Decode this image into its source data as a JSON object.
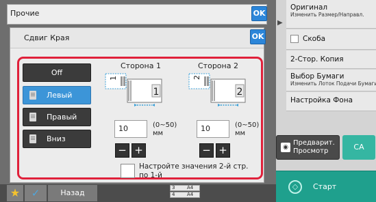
{
  "right_panel": {
    "items": [
      {
        "title": "Оригинал",
        "subtitle": "Изменить Размер/Направл."
      },
      {
        "title": "Скоба",
        "subtitle": ""
      },
      {
        "title": "2-Стор. Копия",
        "subtitle": ""
      },
      {
        "title": "Выбор Бумаги",
        "subtitle": "Изменить Лоток Подачи Бумаги"
      },
      {
        "title": "Настройка Фона",
        "subtitle": ""
      }
    ],
    "preview_button": "Предварит. Просмотр",
    "ca_button": "CA",
    "start_button": "Старт"
  },
  "top_dialog": {
    "title": "Прочие",
    "ok_label": "OK"
  },
  "dialog": {
    "title": "Сдвиг Края",
    "ok_label": "OK",
    "directions": [
      "Off",
      "Левый",
      "Правый",
      "Вниз"
    ],
    "selected_direction": "Левый",
    "side1": {
      "title": "Сторона 1",
      "value": "10",
      "range": "(0~50)",
      "unit": "мм",
      "page_number": "1"
    },
    "side2": {
      "title": "Сторона 2",
      "value": "10",
      "range": "(0~50)",
      "unit": "мм",
      "page_number": "2"
    },
    "second_page_checkbox": {
      "label": "Настройте значения 2-й стр. по 1-й",
      "checked": false
    }
  },
  "bottom": {
    "back_label": "Назад",
    "trays": [
      {
        "num": "3",
        "size": "A4"
      },
      {
        "num": "4",
        "size": "A4"
      }
    ]
  },
  "colors": {
    "accent_blue": "#2c86d9",
    "selected_blue": "#3c95d8",
    "highlight_red": "#e0203a",
    "start_green": "#1fa08d",
    "ca_green": "#35b6a2"
  }
}
